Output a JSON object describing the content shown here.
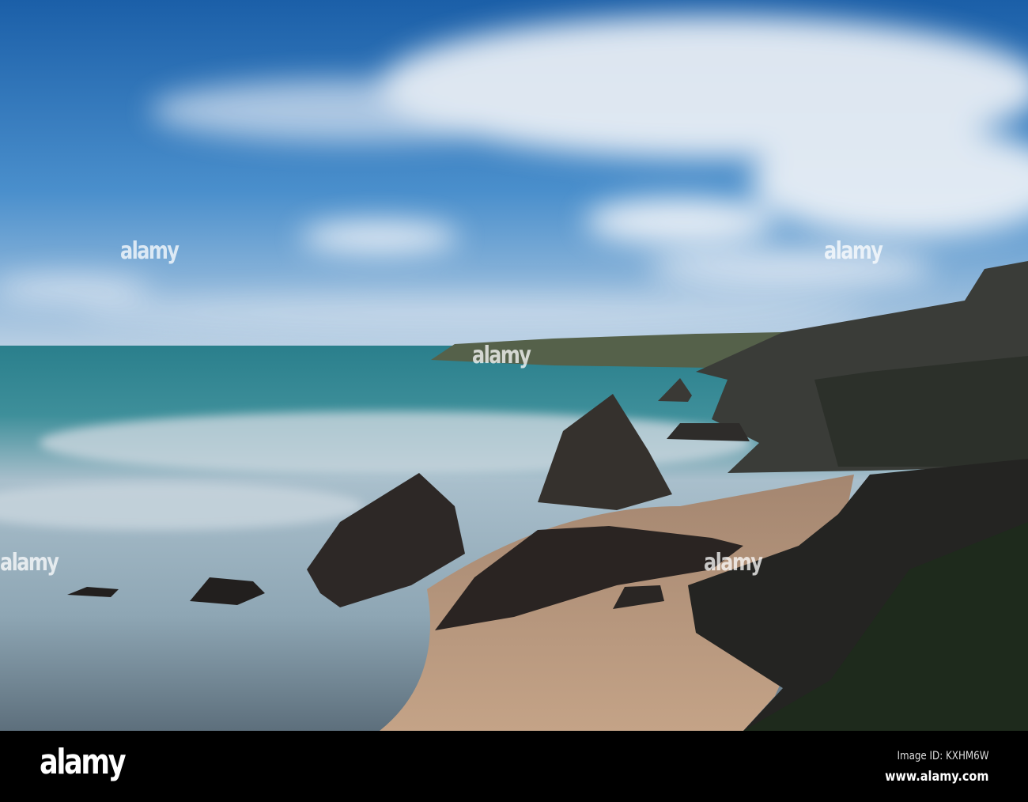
{
  "watermark": {
    "logo": "alamy",
    "image_id_label": "Image ID: KXHM6W",
    "url": "www.alamy.com"
  },
  "scene": {
    "subject": "long-exposure coastline with sea stacks",
    "colors": {
      "sky_top": "#1b63ad",
      "sky_horizon": "#b7cde2",
      "sea": "#2f8a94",
      "mist": "#b8c8d4",
      "sand": "#b8977a",
      "rock": "#2a2624"
    }
  }
}
